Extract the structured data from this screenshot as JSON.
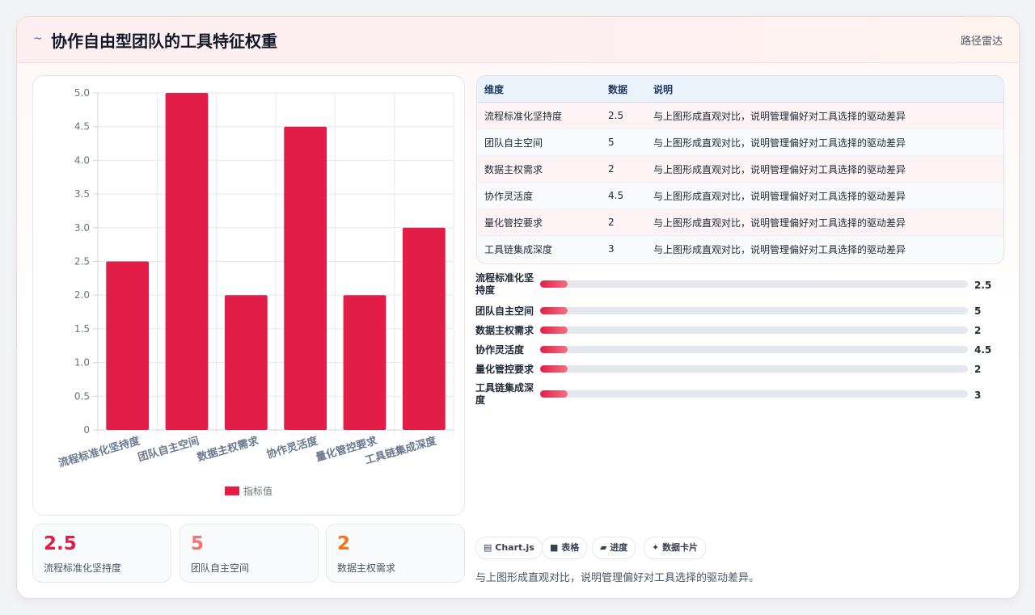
{
  "header": {
    "logo_icon": "~",
    "title": "协作自由型团队的工具特征权重",
    "right_label": "路径雷达"
  },
  "chart_data": {
    "type": "bar",
    "categories": [
      "流程标准化坚持度",
      "团队自主空间",
      "数据主权需求",
      "协作灵活度",
      "量化管控要求",
      "工具链集成深度"
    ],
    "series": [
      {
        "name": "指标值",
        "values": [
          2.5,
          5,
          2,
          4.5,
          2,
          3
        ],
        "color": "#e11d48"
      }
    ],
    "ylim": [
      0,
      5
    ],
    "yticks": [
      "0",
      "0.5",
      "1.0",
      "1.5",
      "2.0",
      "2.5",
      "3.0",
      "3.5",
      "4.0",
      "4.5",
      "5.0"
    ],
    "grid": true,
    "legend": "bottom"
  },
  "stats": [
    {
      "value": "2.5",
      "label": "流程标准化坚持度",
      "color": "#e11d48"
    },
    {
      "value": "5",
      "label": "团队自主空间",
      "color": "#f87171"
    },
    {
      "value": "2",
      "label": "数据主权需求",
      "color": "#f97316"
    }
  ],
  "table": {
    "headers": [
      "维度",
      "数据",
      "说明"
    ],
    "rows": [
      [
        "流程标准化坚持度",
        "2.5",
        "与上图形成直观对比，说明管理偏好对工具选择的驱动差异"
      ],
      [
        "团队自主空间",
        "5",
        "与上图形成直观对比，说明管理偏好对工具选择的驱动差异"
      ],
      [
        "数据主权需求",
        "2",
        "与上图形成直观对比，说明管理偏好对工具选择的驱动差异"
      ],
      [
        "协作灵活度",
        "4.5",
        "与上图形成直观对比，说明管理偏好对工具选择的驱动差异"
      ],
      [
        "量化管控要求",
        "2",
        "与上图形成直观对比，说明管理偏好对工具选择的驱动差异"
      ],
      [
        "工具链集成深度",
        "3",
        "与上图形成直观对比，说明管理偏好对工具选择的驱动差异"
      ]
    ]
  },
  "progress": [
    {
      "label": "流程标准化坚持度",
      "value": "2.5",
      "fill_fraction": 0.065
    },
    {
      "label": "团队自主空间",
      "value": "5",
      "fill_fraction": 0.065
    },
    {
      "label": "数据主权需求",
      "value": "2",
      "fill_fraction": 0.065
    },
    {
      "label": "协作灵活度",
      "value": "4.5",
      "fill_fraction": 0.065
    },
    {
      "label": "量化管控要求",
      "value": "2",
      "fill_fraction": 0.065
    },
    {
      "label": "工具链集成深度",
      "value": "3",
      "fill_fraction": 0.065
    }
  ],
  "chips": [
    {
      "icon": "▤",
      "label": "Chart.js"
    },
    {
      "icon": "■",
      "label": "表格"
    },
    {
      "icon": "▰",
      "label": "进度"
    },
    {
      "icon": "✦",
      "label": "数据卡片"
    }
  ],
  "note": "与上图形成直观对比，说明管理偏好对工具选择的驱动差异。"
}
